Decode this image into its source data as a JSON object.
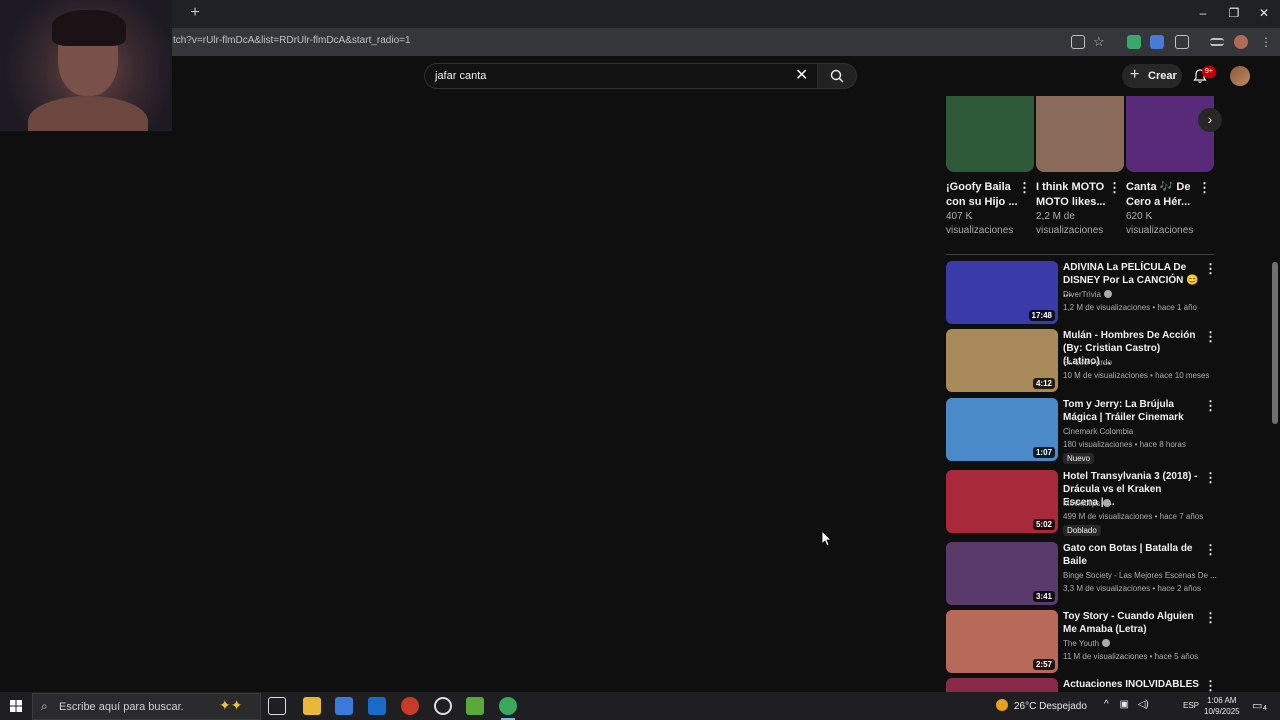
{
  "browser": {
    "url": "tch?v=rUlr-flmDcA&list=RDrUlr-flmDcA&start_radio=1",
    "new_tab": "+",
    "win_minimize": "–",
    "win_restore": "❐",
    "win_close": "✕"
  },
  "header": {
    "search_query": "jafar canta",
    "clear_icon": "✕",
    "create_label": "Crear",
    "create_plus": "+",
    "notifications_badge": "9+"
  },
  "shorts": [
    {
      "title": "¡Goofy Baila con su Hijo ...",
      "views": "407 K visualizaciones",
      "more": "⋮",
      "color": "#2f5a3a"
    },
    {
      "title": "I think MOTO MOTO likes...",
      "views": "2,2 M de visualizaciones",
      "more": "⋮",
      "color": "#8a6a58"
    },
    {
      "title": "Canta 🎶 De Cero a Hér...",
      "views": "620 K visualizaciones",
      "more": "⋮",
      "color": "#5a2a7a"
    }
  ],
  "shorts_next": "›",
  "videos": [
    {
      "title": "ADIVINA La PELÍCULA De DISNEY Por La CANCIÓN 😊 ...",
      "channel": "DiverTrivia",
      "verified": true,
      "meta": "1,2 M de visualizaciones • hace 1 año",
      "duration": "17:48",
      "badge": "",
      "more": "⋮",
      "color": "#3a3aa8"
    },
    {
      "title": "Mulán - Hombres De Acción (By: Cristian Castro) (Latino) ...",
      "channel": "Sr. Leo Pardo",
      "verified": false,
      "meta": "10 M de visualizaciones • hace 10 meses",
      "duration": "4:12",
      "badge": "",
      "more": "⋮",
      "color": "#a88a5a"
    },
    {
      "title": "Tom y Jerry: La Brújula Mágica | Tráiler Cinemark",
      "channel": "Cinemark Colombia",
      "verified": false,
      "meta": "180 visualizaciones • hace 8 horas",
      "duration": "1:07",
      "badge": "Nuevo",
      "more": "⋮",
      "color": "#4a8ac8"
    },
    {
      "title": "Hotel Transylvania 3 (2018) - Drácula vs el Kraken Escena | ...",
      "channel": "Movieclips",
      "verified": true,
      "meta": "499 M de visualizaciones • hace 7 años",
      "duration": "5:02",
      "badge": "Doblado",
      "more": "⋮",
      "color": "#a82a3a"
    },
    {
      "title": "Gato con Botas | Batalla de Baile",
      "channel": "Binge Society - Las Mejores Escenas De ...",
      "verified": false,
      "meta": "3,3 M de visualizaciones • hace 2 años",
      "duration": "3:41",
      "badge": "",
      "more": "⋮",
      "color": "#5a3a6a"
    },
    {
      "title": "Toy Story - Cuando Alguien Me Amaba (Letra)",
      "channel": "The Youth",
      "verified": true,
      "meta": "11 M de visualizaciones • hace 5 años",
      "duration": "2:57",
      "badge": "",
      "more": "⋮",
      "color": "#b86a5a"
    },
    {
      "title": "Actuaciones INOLVIDABLES de",
      "channel": "",
      "verified": false,
      "meta": "",
      "duration": "",
      "badge": "",
      "more": "⋮",
      "color": "#8a2a4a"
    }
  ],
  "taskbar": {
    "search_placeholder": "Escribe aquí para buscar.",
    "weather": "26°C  Despejado",
    "lang": "ESP",
    "time": "1:06 AM",
    "date": "10/9/2025",
    "notif_count": "4"
  }
}
